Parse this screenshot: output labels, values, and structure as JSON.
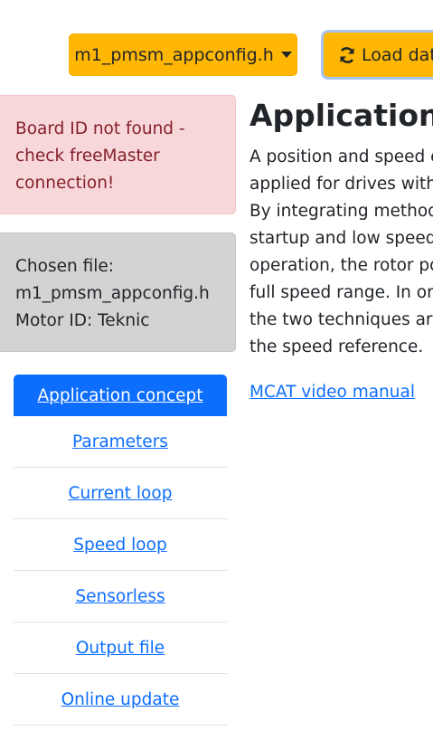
{
  "toolbar": {
    "file_dropdown_label": "m1_pmsm_appconfig.h",
    "load_button_label": "Load dat"
  },
  "alerts": {
    "board_error": [
      "Board ID not found -",
      "check freeMaster",
      "connection!"
    ],
    "file_info": [
      "Chosen file:",
      "m1_pmsm_appconfig.h",
      "Motor ID: Teknic"
    ]
  },
  "nav": {
    "items": [
      {
        "label": "Application concept",
        "active": true
      },
      {
        "label": "Parameters"
      },
      {
        "label": "Current loop"
      },
      {
        "label": "Speed loop"
      },
      {
        "label": "Sensorless"
      },
      {
        "label": "Output file"
      },
      {
        "label": "Online update"
      }
    ]
  },
  "main": {
    "title": "Application c",
    "paragraph_lines": [
      "A position and speed e",
      "applied for drives with",
      "By integrating methods",
      "startup and low speed a",
      "operation, the rotor po",
      "full speed range. In ord",
      "the two techniques are",
      "the speed reference."
    ],
    "video_link": "MCAT video manual"
  },
  "colors": {
    "warning": "#ffb703",
    "primary": "#0d6efd",
    "danger_bg": "#f8d7da",
    "danger_text": "#842029",
    "secondary_bg": "#d3d3d3"
  },
  "icons": {
    "load": "sync-icon",
    "dropdown": "caret-down-icon"
  }
}
